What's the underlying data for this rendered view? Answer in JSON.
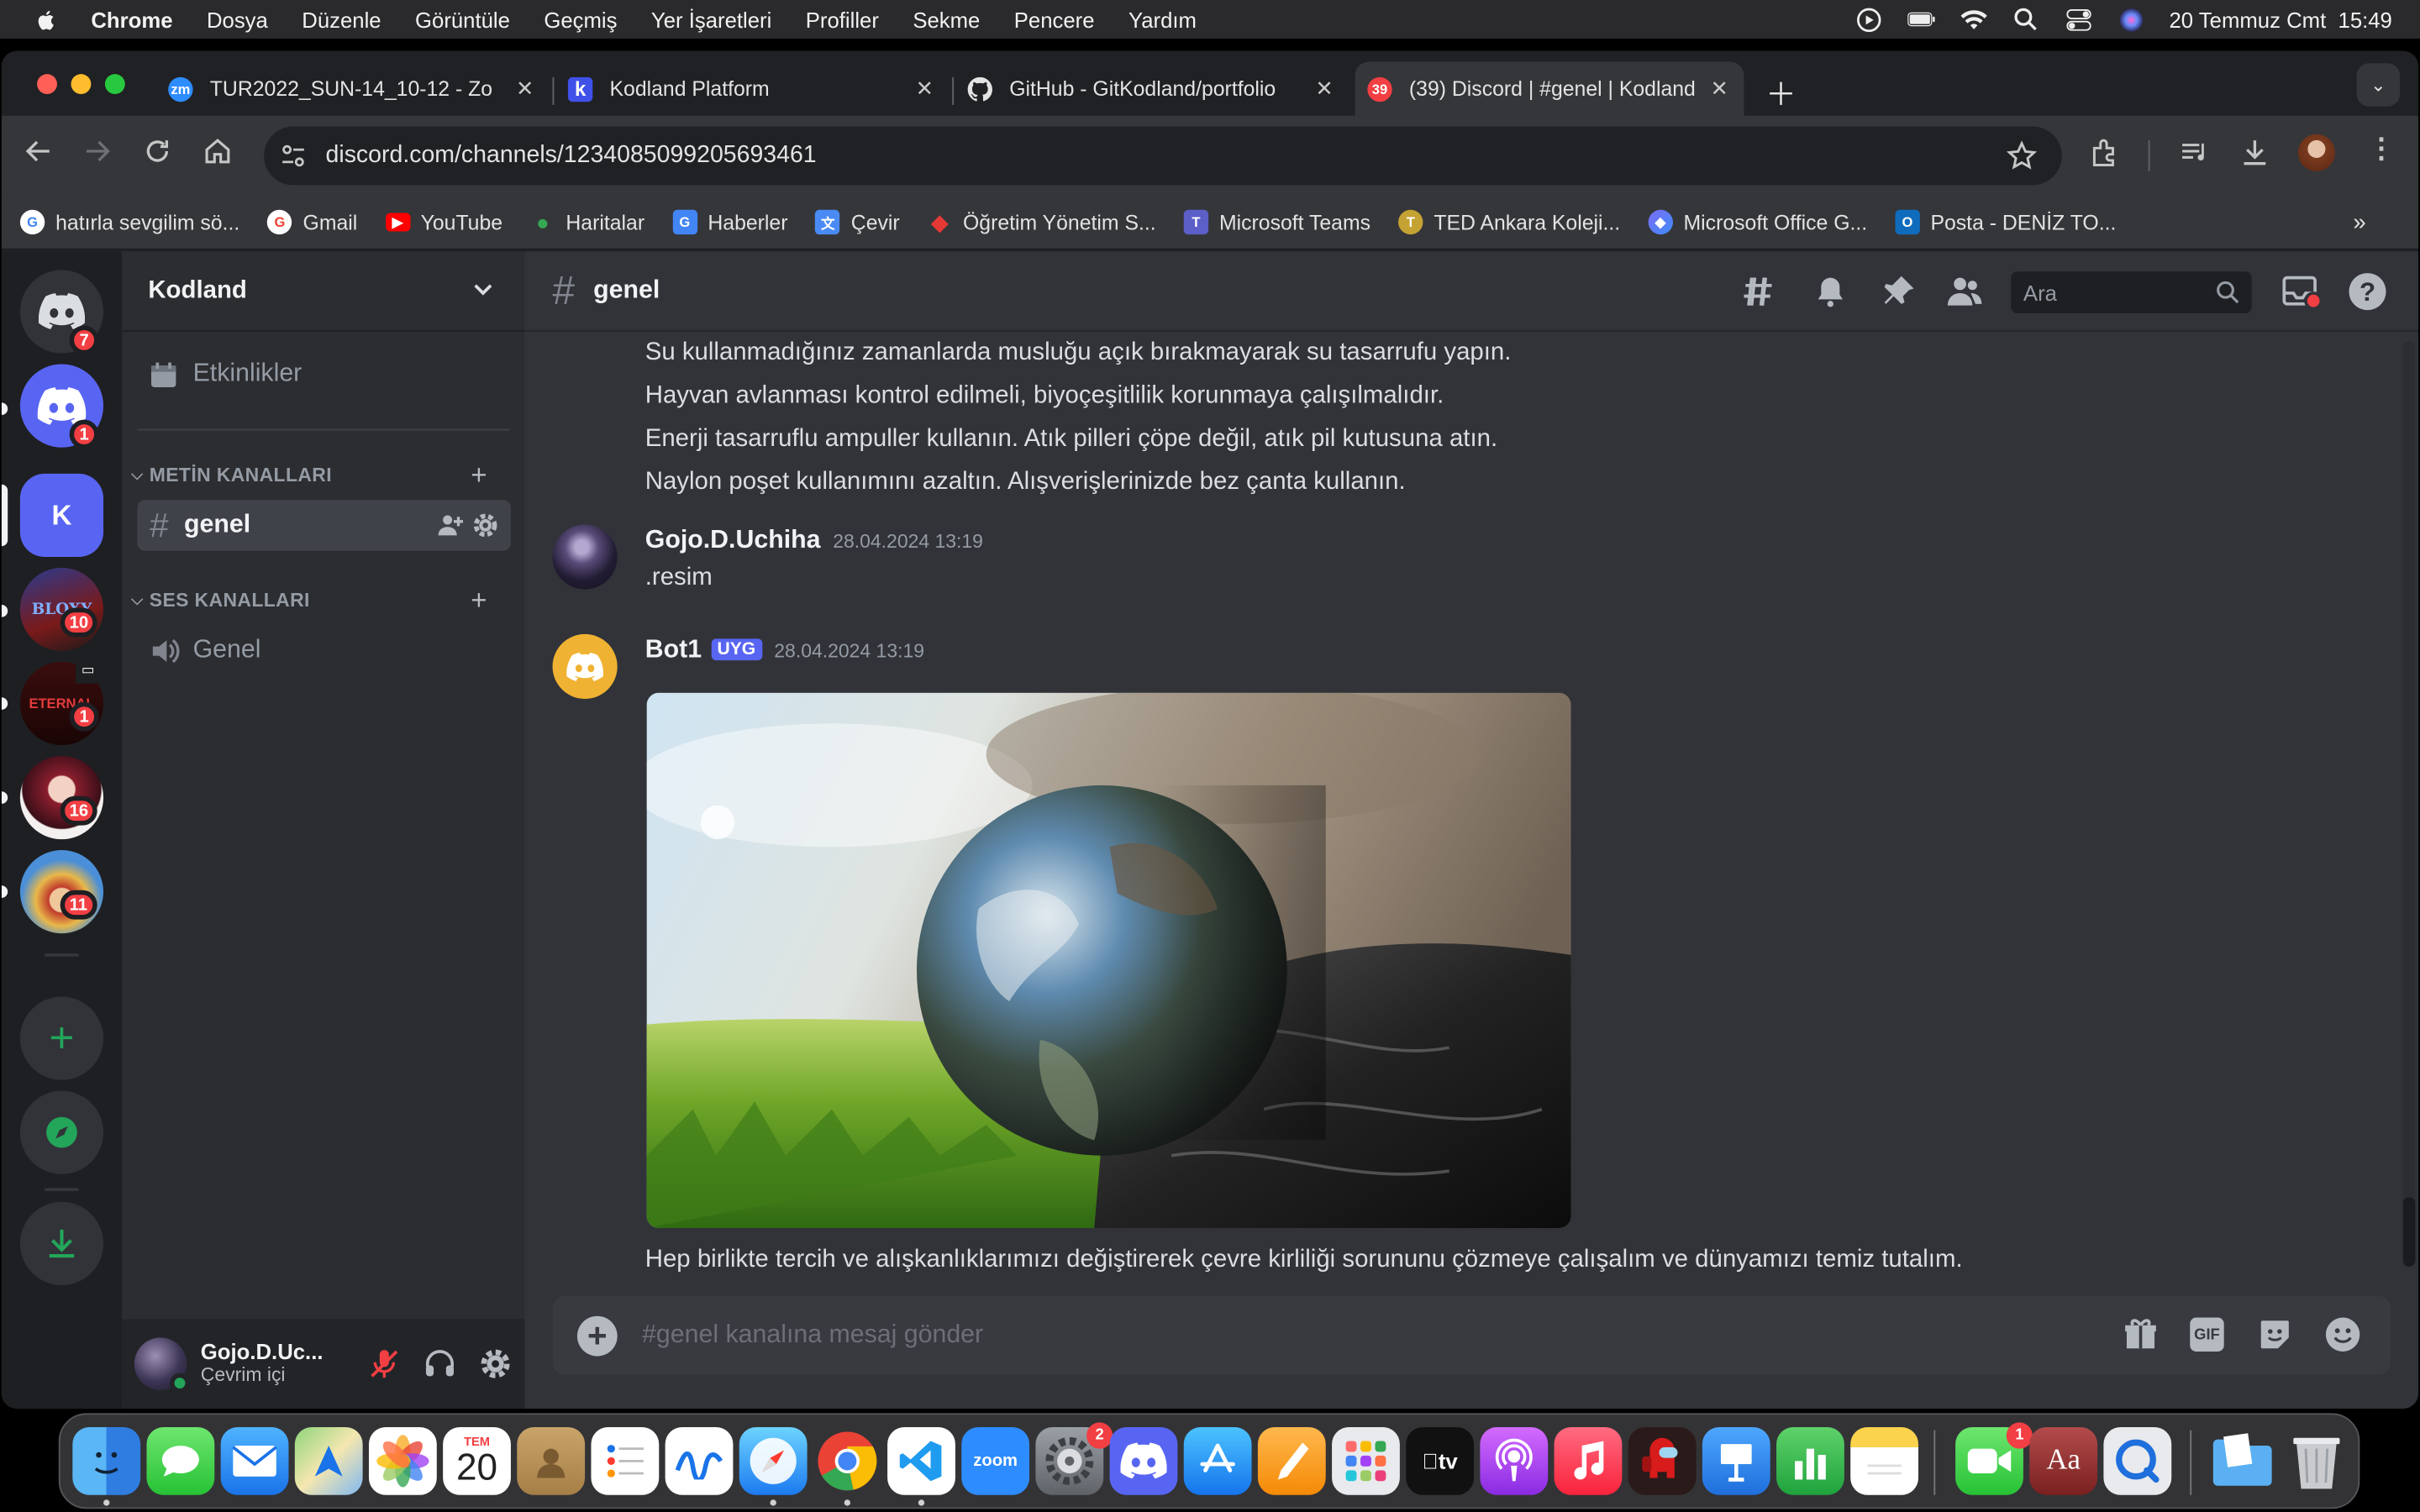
{
  "menubar": {
    "app": "Chrome",
    "items": [
      "Dosya",
      "Düzenle",
      "Görüntüle",
      "Geçmiş",
      "Yer İşaretleri",
      "Profiller",
      "Sekme",
      "Pencere",
      "Yardım"
    ],
    "datetime": "20 Temmuz Cmt  15:49"
  },
  "tabs": [
    {
      "title": "TUR2022_SUN-14_10-12 - Zo",
      "icon": "zoom-icon",
      "favicon_text": "zm"
    },
    {
      "title": "Kodland Platform",
      "icon": "kodland-icon"
    },
    {
      "title": "GitHub - GitKodland/portfolio",
      "icon": "github-icon"
    },
    {
      "title": "(39) Discord | #genel | Kodland",
      "icon": "discord-icon",
      "favicon_text": "39",
      "active": true
    }
  ],
  "address": {
    "url": "discord.com/channels/1234085099205693461"
  },
  "bookmarks": [
    {
      "label": "hatırla sevgilim sö...",
      "icon": "google-icon"
    },
    {
      "label": "Gmail",
      "icon": "google-icon"
    },
    {
      "label": "YouTube",
      "icon": "youtube-icon"
    },
    {
      "label": "Haritalar",
      "icon": "maps-icon"
    },
    {
      "label": "Haberler",
      "icon": "news-icon"
    },
    {
      "label": "Çevir",
      "icon": "translate-icon"
    },
    {
      "label": "Öğretim Yönetim S...",
      "icon": "lms-icon"
    },
    {
      "label": "Microsoft Teams",
      "icon": "teams-icon"
    },
    {
      "label": "TED Ankara Koleji...",
      "icon": "ted-icon"
    },
    {
      "label": "Microsoft Office G...",
      "icon": "office-icon"
    },
    {
      "label": "Posta - DENİZ TO...",
      "icon": "outlook-icon"
    }
  ],
  "servers": {
    "home_badge": "7",
    "items": [
      {
        "name": "discord-server",
        "badge": "1"
      },
      {
        "name": "kodland-server",
        "letter": "K"
      },
      {
        "name": "bloxy-server",
        "text": "BLOXY",
        "badge": "10"
      },
      {
        "name": "eternal-server",
        "text": "ETERNAL",
        "badge": "1"
      },
      {
        "name": "anime-server",
        "badge": "16"
      },
      {
        "name": "pirate-server",
        "badge": "11"
      }
    ]
  },
  "guild": {
    "name": "Kodland",
    "events_label": "Etkinlikler",
    "text_category": "METİN KANALLARI",
    "voice_category": "SES KANALLARI",
    "text_channel": "genel",
    "voice_channel": "Genel"
  },
  "user": {
    "name": "Gojo.D.Uc...",
    "status": "Çevrim içi"
  },
  "channel": {
    "name": "genel",
    "search_placeholder": "Ara"
  },
  "messages": {
    "previous_lines": [
      "Su kullanmadığınız zamanlarda musluğu açık bırakmayarak su tasarrufu yapın.",
      "Hayvan avlanması kontrol edilmeli, biyoçeşitlilik korunmaya çalışılmalıdır.",
      "Enerji tasarruflu ampuller kullanın. Atık pilleri çöpe değil, atık pil kutusuna atın.",
      "Naylon poşet kullanımını azaltın. Alışverişlerinizde bez çanta kullanın."
    ],
    "user_msg": {
      "author": "Gojo.D.Uchiha",
      "time": "28.04.2024 13:19",
      "text": ".resim"
    },
    "bot_msg": {
      "author": "Bot1",
      "tag": "UYG",
      "time": "28.04.2024 13:19",
      "caption": "Hep birlikte tercih ve alışkanlıklarımızı değiştirerek çevre kirliliği sorununu çözmeye çalışalım ve dünyamızı temiz tutalım."
    }
  },
  "composer": {
    "placeholder": "#genel kanalına mesaj gönder"
  },
  "dock": {
    "calendar_month": "TEM",
    "calendar_day": "20",
    "system_settings_badge": "2",
    "facetime_badge": "1",
    "zoom_label": "zoom",
    "tv_label": "tv",
    "dictionary_label": "Aa"
  },
  "colors": {
    "discord_blurple": "#5865f2",
    "online": "#23a55a",
    "badge_red": "#f23f43"
  }
}
